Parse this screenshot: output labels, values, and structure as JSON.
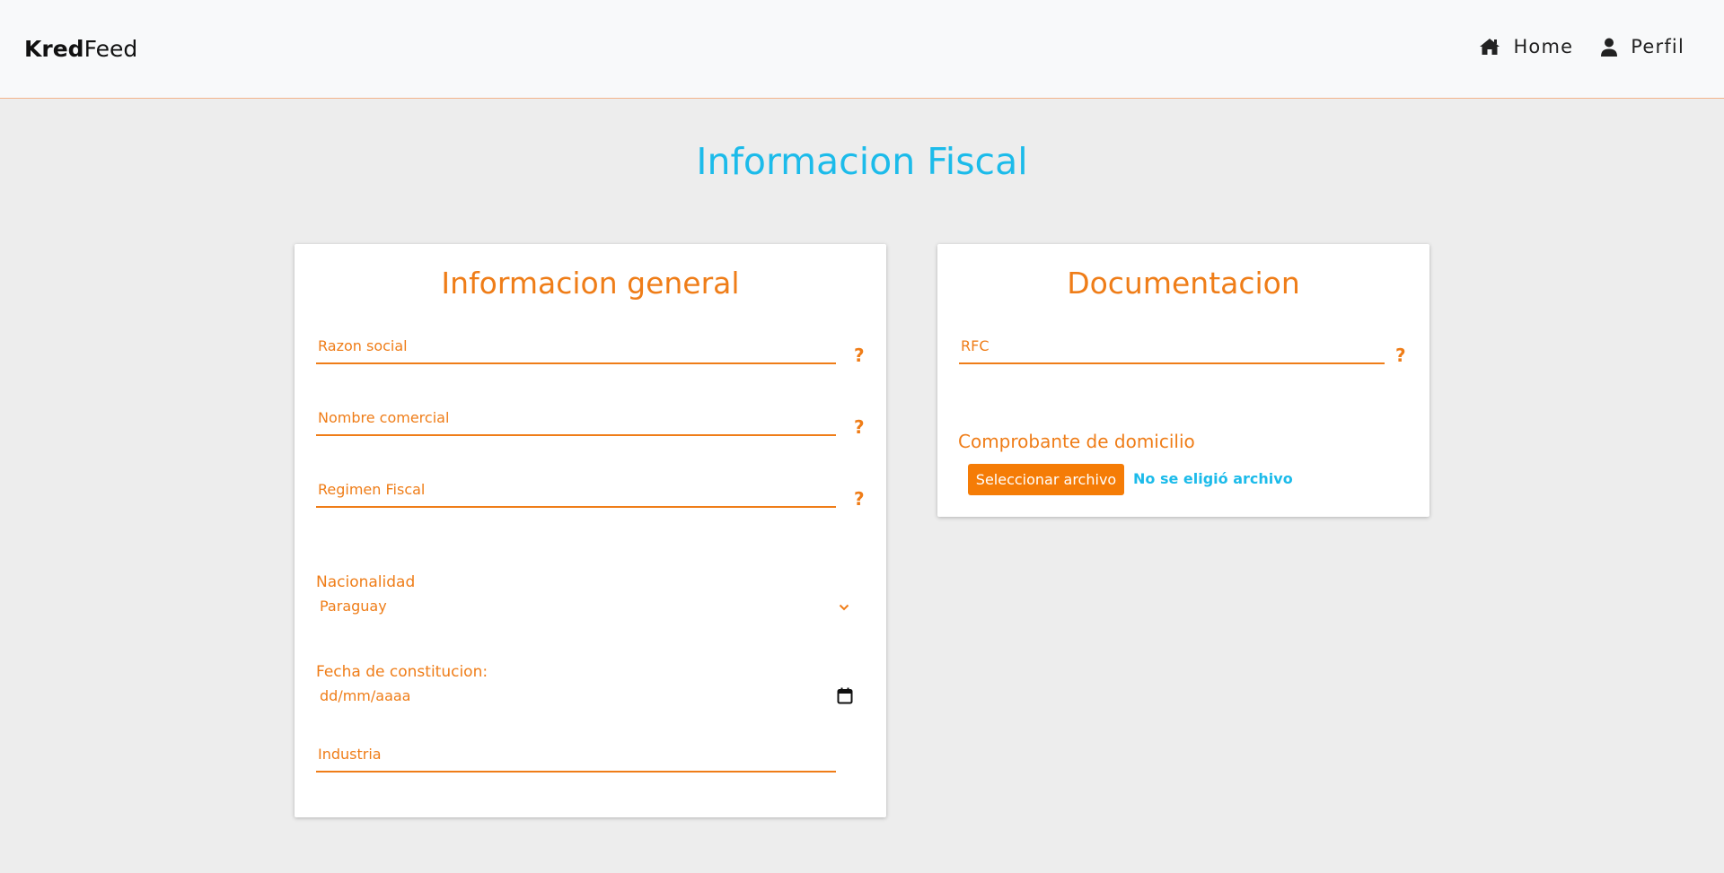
{
  "header": {
    "logo_bold": "Kred",
    "logo_light": "Feed",
    "nav": [
      {
        "label": "Home",
        "icon": "home-icon"
      },
      {
        "label": "Perfil",
        "icon": "user-icon"
      }
    ]
  },
  "page": {
    "title": "Informacion Fiscal"
  },
  "general": {
    "title": "Informacion general",
    "razon_social_label": "Razon social",
    "nombre_comercial_label": "Nombre comercial",
    "regimen_fiscal_label": "Regimen Fiscal",
    "nacionalidad_label": "Nacionalidad",
    "nacionalidad_value": "Paraguay",
    "fecha_label": "Fecha de constitucion:",
    "fecha_placeholder": "dd/mm/aaaa",
    "industria_label": "Industria",
    "help_mark": "?"
  },
  "docs": {
    "title": "Documentacion",
    "rfc_label": "RFC",
    "comprobante_label": "Comprobante de domicilio",
    "file_button": "Seleccionar archivo",
    "file_status": "No se eligió archivo",
    "help_mark": "?"
  },
  "colors": {
    "accent_orange": "#ef7d18",
    "accent_blue": "#1cbbea",
    "background": "#ededed"
  }
}
